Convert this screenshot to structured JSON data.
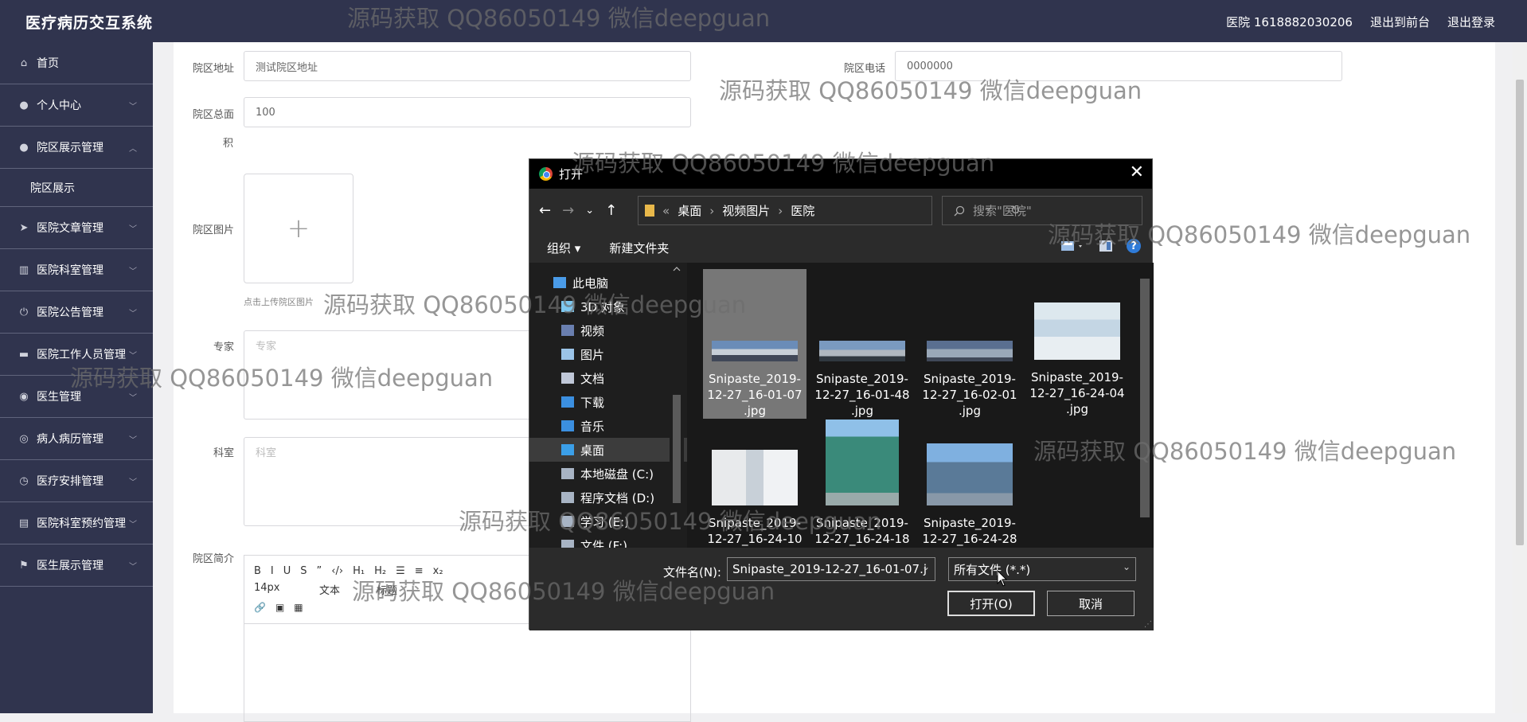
{
  "header": {
    "app_title": "医疗病历交互系统",
    "user_label": "医院 1618882030206",
    "to_front_label": "退出到前台",
    "logout_label": "退出登录"
  },
  "sidebar": {
    "items": [
      {
        "label": "首页",
        "icon": "home-icon"
      },
      {
        "label": "个人中心",
        "icon": "person-icon"
      },
      {
        "label": "院区展示管理",
        "icon": "person-icon",
        "expanded": true
      },
      {
        "label": "院区展示",
        "sub": true
      },
      {
        "label": "医院文章管理",
        "icon": "send-icon"
      },
      {
        "label": "医院科室管理",
        "icon": "bars-icon"
      },
      {
        "label": "医院公告管理",
        "icon": "power-icon"
      },
      {
        "label": "医院工作人员管理",
        "icon": "briefcase-icon"
      },
      {
        "label": "医生管理",
        "icon": "compass-icon"
      },
      {
        "label": "病人病历管理",
        "icon": "record-icon"
      },
      {
        "label": "医疗安排管理",
        "icon": "clock-icon"
      },
      {
        "label": "医院科室预约管理",
        "icon": "clipboard-icon"
      },
      {
        "label": "医生展示管理",
        "icon": "flag-icon"
      }
    ]
  },
  "form": {
    "address_label": "院区地址",
    "address_value": "测试院区地址",
    "phone_label": "院区电话",
    "phone_value": "0000000",
    "area_label": "院区总面",
    "area_label_2": "积",
    "area_value": "100",
    "image_label": "院区图片",
    "upload_plus": "+",
    "upload_hint": "点击上传院区图片",
    "expert_label": "专家",
    "expert_placeholder": "专家",
    "dept_label": "科室",
    "dept_placeholder": "科室",
    "intro_label": "院区简介",
    "editor_toolbar_row1": [
      "B",
      "I",
      "U",
      "S",
      "”",
      "‹/›",
      "H₁",
      "H₂",
      "☰",
      "≡",
      "x₂"
    ],
    "editor_font_size": "14px",
    "editor_font_label": "文本",
    "editor_heading_label": "标题",
    "editor_toolbar_row3": [
      "link-icon",
      "image-icon",
      "video-icon"
    ]
  },
  "watermark_text": "源码获取 QQ86050149 微信deepguan",
  "dialog": {
    "title": "打开",
    "close_glyph": "✕",
    "back_glyph": "←",
    "forward_glyph": "→",
    "down_glyph": "⌄",
    "up_glyph": "↑",
    "breadcrumb_prefix": "«",
    "breadcrumb": [
      "桌面",
      "视频图片",
      "医院"
    ],
    "sep": "›",
    "refresh_glyph": "↻",
    "search_placeholder": "搜索\"医院\"",
    "organize_label": "组织 ▾",
    "new_folder_label": "新建文件夹",
    "help_glyph": "?",
    "nav_items": [
      {
        "label": "此电脑",
        "icon": "pc-icon",
        "top": true
      },
      {
        "label": "3D 对象",
        "icon": "cube-icon"
      },
      {
        "label": "视频",
        "icon": "video-folder-icon"
      },
      {
        "label": "图片",
        "icon": "pictures-folder-icon"
      },
      {
        "label": "文档",
        "icon": "documents-folder-icon"
      },
      {
        "label": "下载",
        "icon": "download-folder-icon"
      },
      {
        "label": "音乐",
        "icon": "music-folder-icon"
      },
      {
        "label": "桌面",
        "icon": "desktop-folder-icon",
        "selected": true
      },
      {
        "label": "本地磁盘 (C:)",
        "icon": "drive-icon"
      },
      {
        "label": "程序文档 (D:)",
        "icon": "drive-icon"
      },
      {
        "label": "学习 (E:)",
        "icon": "drive-icon"
      },
      {
        "label": "文件 (F:)",
        "icon": "drive-icon"
      }
    ],
    "files": [
      {
        "name": "Snipaste_2019-12-27_16-01-07.jpg",
        "l1": "Snipaste_2019-",
        "l2": "12-27_16-01-07",
        "l3": ".jpg",
        "selected": true
      },
      {
        "name": "Snipaste_2019-12-27_16-01-48.jpg",
        "l1": "Snipaste_2019-",
        "l2": "12-27_16-01-48",
        "l3": ".jpg"
      },
      {
        "name": "Snipaste_2019-12-27_16-02-01.jpg",
        "l1": "Snipaste_2019-",
        "l2": "12-27_16-02-01",
        "l3": ".jpg"
      },
      {
        "name": "Snipaste_2019-12-27_16-24-04.jpg",
        "l1": "Snipaste_2019-",
        "l2": "12-27_16-24-04",
        "l3": ".jpg"
      },
      {
        "name": "Snipaste_2019-12-27_16-24-10",
        "l1": "Snipaste_2019-",
        "l2": "12-27_16-24-10"
      },
      {
        "name": "Snipaste_2019-12-27_16-24-18",
        "l1": "Snipaste_2019-",
        "l2": "12-27_16-24-18"
      },
      {
        "name": "Snipaste_2019-12-27_16-24-28",
        "l1": "Snipaste_2019-",
        "l2": "12-27_16-24-28"
      }
    ],
    "filename_label": "文件名(N):",
    "filename_value": "Snipaste_2019-12-27_16-01-07.j",
    "filetype_value": "所有文件 (*.*)",
    "open_label": "打开(O)",
    "cancel_label": "取消"
  },
  "colors": {
    "sidebar_bg": "#30344e",
    "dialog_bg": "#2b2b2b",
    "help_blue": "#2f7bd8"
  }
}
